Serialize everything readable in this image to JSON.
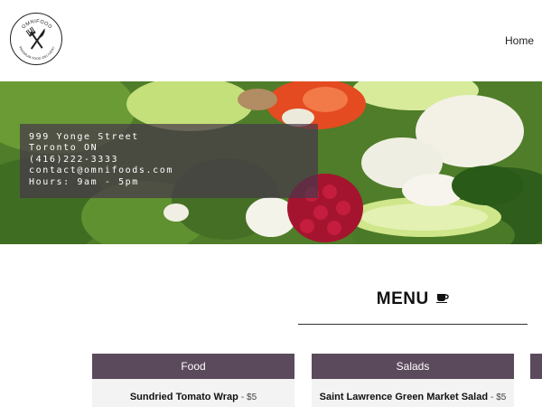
{
  "logo": {
    "top_text": "OMNIFOOD",
    "bottom_text": "PREMIUM FOOD DELIVERY",
    "icon": "fork-and-knife-icon"
  },
  "nav": {
    "home": "Home"
  },
  "contact": {
    "address": "999 Yonge Street",
    "city": "Toronto ON",
    "phone": "(416)222-3333",
    "email": "contact@omnifoods.com",
    "hours": "Hours: 9am - 5pm"
  },
  "menu": {
    "title": "MENU",
    "icon": "coffee-cup-icon",
    "categories": [
      {
        "name": "Food",
        "item": "Sundried Tomato Wrap",
        "price": "$5"
      },
      {
        "name": "Salads",
        "item": "Saint Lawrence Green Market Salad",
        "price": "$5"
      }
    ]
  },
  "colors": {
    "card_header": "#5b4a5c",
    "contact_overlay": "#46374b",
    "card_body": "#f3f3f3"
  }
}
